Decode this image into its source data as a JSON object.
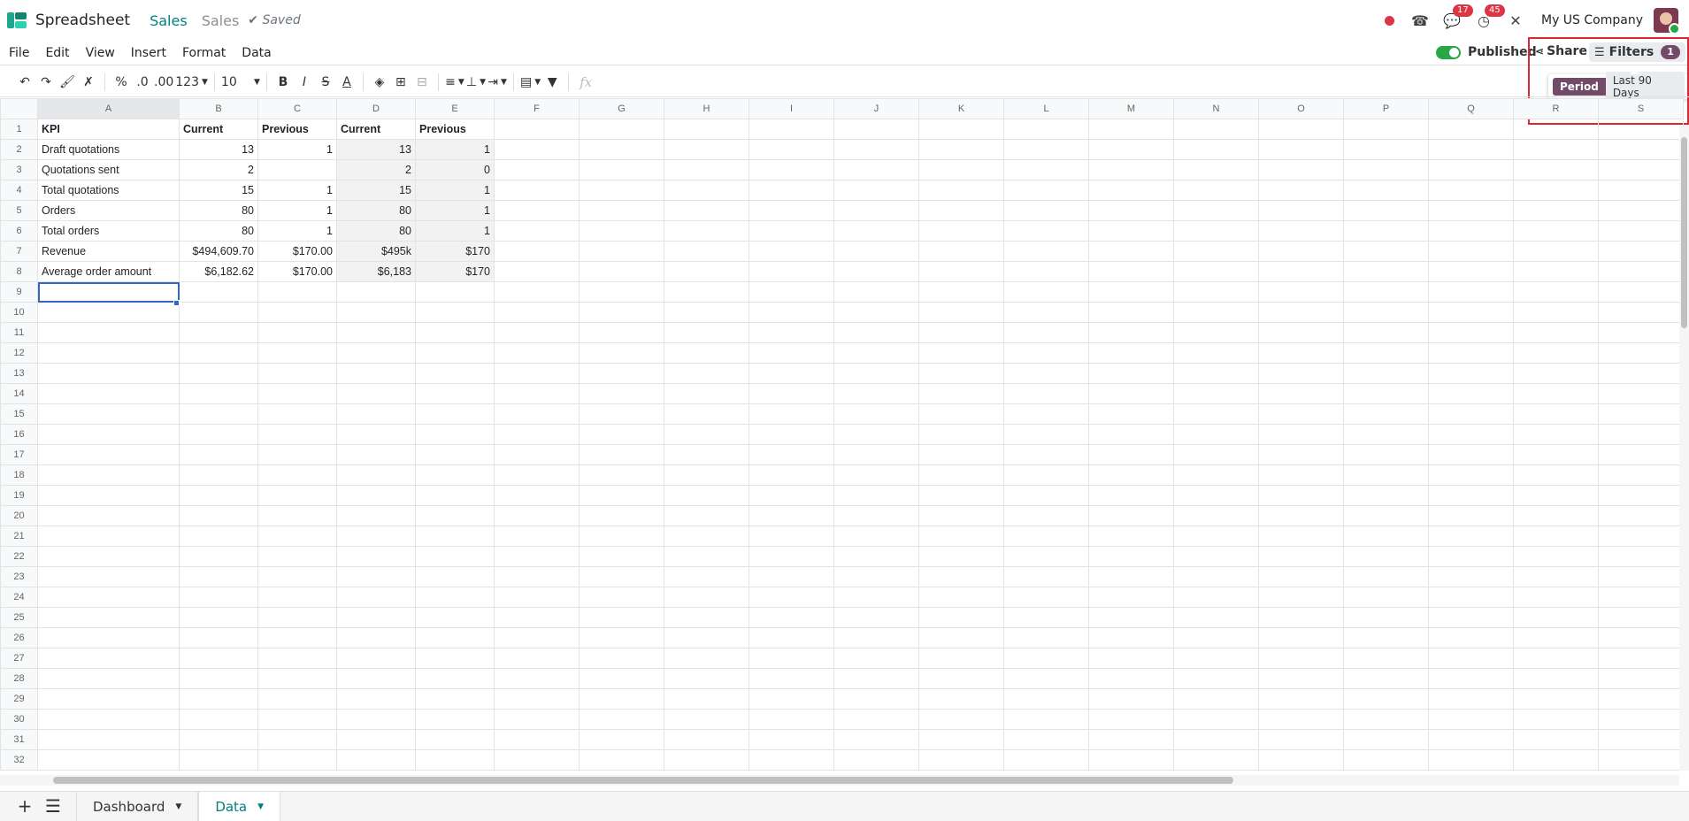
{
  "header": {
    "app_name": "Spreadsheet",
    "breadcrumb": "Sales",
    "doc_name": "Sales",
    "saved_label": "Saved",
    "company": "My US Company",
    "messages_count": "17",
    "activities_count": "45"
  },
  "menu": [
    "File",
    "Edit",
    "View",
    "Insert",
    "Format",
    "Data"
  ],
  "publish": {
    "label": "Published",
    "on": true
  },
  "share_label": "Share",
  "filters": {
    "label": "Filters",
    "count": "1",
    "facet_name": "Period",
    "facet_value": "Last 90 Days"
  },
  "toolbar": {
    "font_size": "10",
    "formula_placeholder": "fx"
  },
  "grid": {
    "columns": [
      "A",
      "B",
      "C",
      "D",
      "E",
      "F",
      "G",
      "H",
      "I",
      "J",
      "K",
      "L",
      "M",
      "N",
      "O",
      "P",
      "Q",
      "R",
      "S"
    ],
    "row_count": 32,
    "rows": [
      [
        "KPI",
        "Current",
        "Previous",
        "Current",
        "Previous"
      ],
      [
        "Draft quotations",
        "13",
        "1",
        "13",
        "1"
      ],
      [
        "Quotations sent",
        "2",
        "",
        "2",
        "0"
      ],
      [
        "Total quotations",
        "15",
        "1",
        "15",
        "1"
      ],
      [
        "Orders",
        "80",
        "1",
        "80",
        "1"
      ],
      [
        "Total orders",
        "80",
        "1",
        "80",
        "1"
      ],
      [
        "Revenue",
        "$494,609.70",
        "$170.00",
        "$495k",
        "$170"
      ],
      [
        "Average order amount",
        "$6,182.62",
        "$170.00",
        "$6,183",
        "$170"
      ]
    ]
  },
  "sheets": {
    "tabs": [
      "Dashboard",
      "Data"
    ],
    "active": "Data"
  },
  "colors": {
    "accent": "#017e84",
    "purple": "#714b67",
    "badge": "#dc3545",
    "selection": "#3266ca"
  }
}
